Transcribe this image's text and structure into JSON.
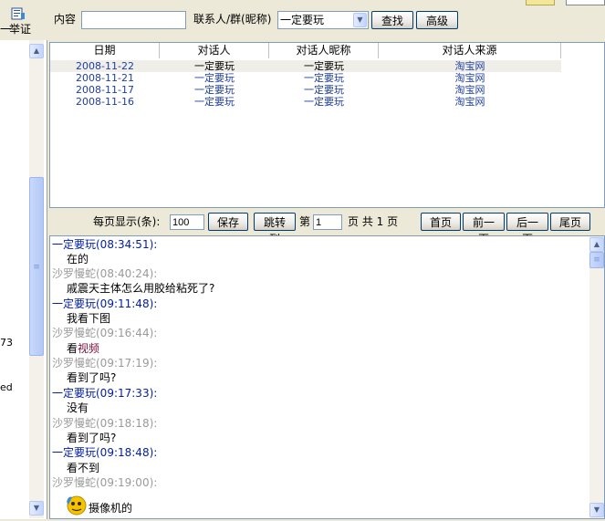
{
  "toolbar": {
    "report_label": "举证",
    "content_label": "内容",
    "content_value": "",
    "contact_label": "联系人/群(昵称)",
    "contact_value": "一定要玩",
    "search_label": "查找",
    "advanced_label": "高级"
  },
  "left": {
    "partial_texts": [
      "73",
      "ed"
    ]
  },
  "grid": {
    "columns": [
      "日期",
      "对话人",
      "对话人昵称",
      "对话人来源"
    ],
    "rows": [
      [
        "2008-11-22",
        "一定要玩",
        "一定要玩",
        "淘宝网"
      ],
      [
        "2008-11-21",
        "一定要玩",
        "一定要玩",
        "淘宝网"
      ],
      [
        "2008-11-17",
        "一定要玩",
        "一定要玩",
        "淘宝网"
      ],
      [
        "2008-11-16",
        "一定要玩",
        "一定要玩",
        "淘宝网"
      ]
    ]
  },
  "pager": {
    "per_page_label": "每页显示(条):",
    "per_page_value": "100",
    "save_label": "保存",
    "jump_label": "跳转到",
    "page_prefix": "第",
    "page_value": "1",
    "page_suffix": "页 共 1 页",
    "first_label": "首页",
    "prev_label": "前一页",
    "next_label": "后一页",
    "last_label": "尾页"
  },
  "chat": {
    "lines": [
      {
        "kind": "me",
        "text": "一定要玩(08:34:51):"
      },
      {
        "kind": "msg",
        "text": "在的"
      },
      {
        "kind": "other",
        "text": "沙罗慢蛇(08:40:24):"
      },
      {
        "kind": "msg",
        "text": "戚震天主体怎么用胶给粘死了?"
      },
      {
        "kind": "me",
        "text": "一定要玩(09:11:48):"
      },
      {
        "kind": "msg",
        "text": "我看下图"
      },
      {
        "kind": "other",
        "text": "沙罗慢蛇(09:16:44):"
      },
      {
        "kind": "msg_mixed",
        "text": "看",
        "extra": "视频"
      },
      {
        "kind": "other",
        "text": "沙罗慢蛇(09:17:19):"
      },
      {
        "kind": "msg",
        "text": "看到了吗?"
      },
      {
        "kind": "me",
        "text": "一定要玩(09:17:33):"
      },
      {
        "kind": "msg",
        "text": "没有"
      },
      {
        "kind": "other",
        "text": "沙罗慢蛇(09:18:18):"
      },
      {
        "kind": "msg",
        "text": "看到了吗?"
      },
      {
        "kind": "me",
        "text": "一定要玩(09:18:48):"
      },
      {
        "kind": "msg",
        "text": "看不到"
      },
      {
        "kind": "other",
        "text": "沙罗慢蛇(09:19:00):"
      },
      {
        "kind": "msg_icon",
        "text": "摄像机的"
      }
    ]
  },
  "colors": {
    "me": "#001e9e",
    "other": "#9a9a9a",
    "link_row": "#1f3fa0",
    "video_text": "#7a0f3a"
  }
}
